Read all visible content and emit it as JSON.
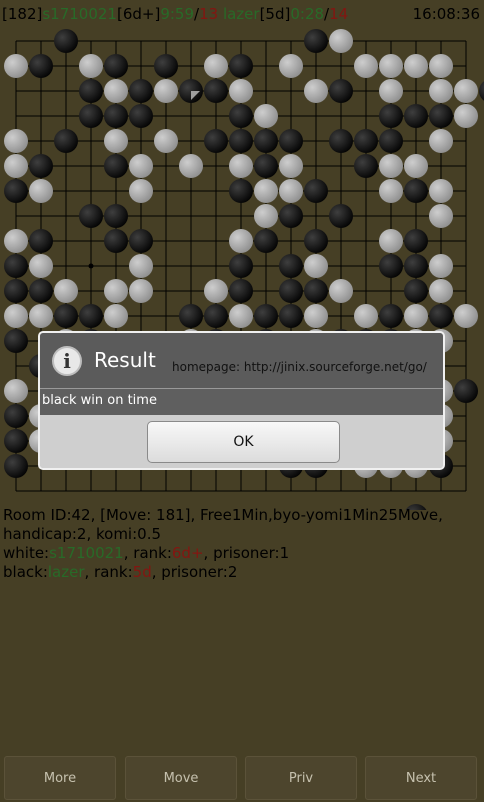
{
  "status": {
    "move_bracket": "[182]",
    "white_name": "s1710021",
    "white_rank": "[6d+]",
    "white_time": "9:59",
    "slash1": "/",
    "white_periods": "13",
    "black_name": "lazer",
    "black_rank": "[5d]",
    "black_time": "0:28",
    "slash2": "/",
    "black_periods": "14",
    "clock": "16:08:36"
  },
  "colors": {
    "background": "#534a2c",
    "green": "#2f7d2f",
    "red": "#9b1a14"
  },
  "board": {
    "size": 19,
    "last_move": [
      7,
      2
    ],
    "stars": [
      [
        3,
        3
      ],
      [
        3,
        9
      ],
      [
        3,
        15
      ],
      [
        9,
        3
      ],
      [
        9,
        9
      ],
      [
        9,
        15
      ],
      [
        15,
        3
      ],
      [
        15,
        9
      ],
      [
        15,
        15
      ]
    ],
    "rows": [
      "..B.........BW.....",
      "WB.WB.B.WB.W..WWWW.",
      "...BWBWBBW..WB.W.WWB",
      "...BBB...BW....BBBW.",
      "W.B.W.W.BBBB.BBB.W.",
      "WB..BW.W.WBW..BWW..",
      "BW...W...BWWB..WBW.",
      "...BB.....WB.B...W.",
      "WB..BB...WB.B..WB..",
      "BW...W...B.BW..BBW.",
      "BBW.WW..WB.BBW..BW.",
      "WWBBW..BBWBBW.WBWBW",
      "B.WB...WB.B.WBBBWW.",
      ".BBB..W.BW..WBBWW..",
      "W..........WWWB.BWB",
      "BW.........BW.B..W.",
      "BW.........WWW.WBW.",
      "B..........BB.WWWB.",
      "....................",
      "................B..."
    ]
  },
  "info": {
    "line1": "Room ID:42, [Move: 181], Free1Min,byo-yomi1Min25Move,",
    "line2": "handicap:2, komi:0.5",
    "white_label": "white:",
    "white_name": "s1710021",
    "rank_label1": ", rank:",
    "white_rank": "6d+",
    "white_prisoner": ", prisoner:1",
    "black_label": "black:",
    "black_name": "lazer",
    "rank_label2": ", rank:",
    "black_rank": "5d",
    "black_prisoner": ", prisoner:2"
  },
  "dialog": {
    "icon": "info-icon",
    "title": "Result",
    "homepage": "homepage: http://jinix.sourceforge.net/go/",
    "message": "black win on time",
    "ok_label": "OK"
  },
  "bottom": {
    "more": "More",
    "move": "Move",
    "priv": "Priv",
    "next": "Next"
  }
}
